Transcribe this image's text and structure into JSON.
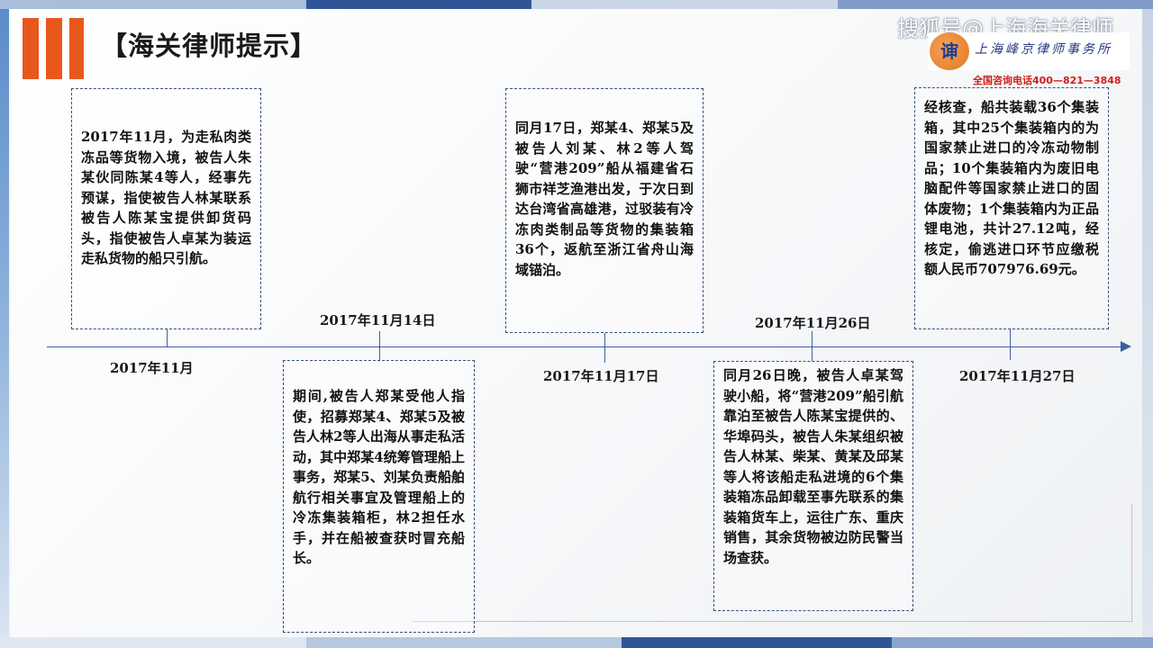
{
  "header": {
    "title": "【海关律师提示】",
    "watermark": "搜狐号@上海海关律师",
    "firm_badge": "谉",
    "firm_name": "上海峰京律师事务所",
    "hotline": "全国咨询电话400—821—3848"
  },
  "colors": {
    "accent": "#e8581c",
    "axis": "#3e5e9e",
    "hotline": "#d0201b"
  },
  "timeline": {
    "events": [
      {
        "date": "2017年11月",
        "text": "2017年11月，为走私肉类冻品等货物入境，被告人朱某伙同陈某4等人，经事先预谋，指使被告人林某联系被告人陈某宝提供卸货码头，指使被告人卓某为装运走私货物的船只引航。"
      },
      {
        "date": "2017年11月14日",
        "text": "期间,被告人郑某受他人指使，招募郑某4、郑某5及被告人林2等人出海从事走私活动，其中郑某4统筹管理船上事务，郑某5、刘某负责船舶航行相关事宜及管理船上的冷冻集装箱柜，林2担任水手，并在船被查获时冒充船长。"
      },
      {
        "date": "2017年11月17日",
        "text": "同月17日，郑某4、郑某5及被告人刘某、林2等人驾驶“营港209”船从福建省石狮市祥芝渔港出发，于次日到达台湾省高雄港，过驳装有冷冻肉类制品等货物的集装箱36个，返航至浙江省舟山海域锚泊。"
      },
      {
        "date": "2017年11月26日",
        "text": "同月26日晚，被告人卓某驾驶小船，将“营港209”船引航靠泊至被告人陈某宝提供的、华埠码头，被告人朱某组织被告人林某、柴某、黄某及邱某等人将该船走私进境的6个集装箱冻品卸载至事先联系的集装箱货车上，运往广东、重庆销售，其余货物被边防民警当场查获。"
      },
      {
        "date": "2017年11月27日",
        "text": "经核查，船共装载36个集装箱，其中25个集装箱内的为国家禁止进口的冷冻动物制品；10个集装箱内为废旧电脑配件等国家禁止进口的固体废物；1个集装箱内为正品锂电池，共计27.12吨，经核定，偷逃进口环节应缴税额人民币707976.69元。"
      }
    ]
  }
}
